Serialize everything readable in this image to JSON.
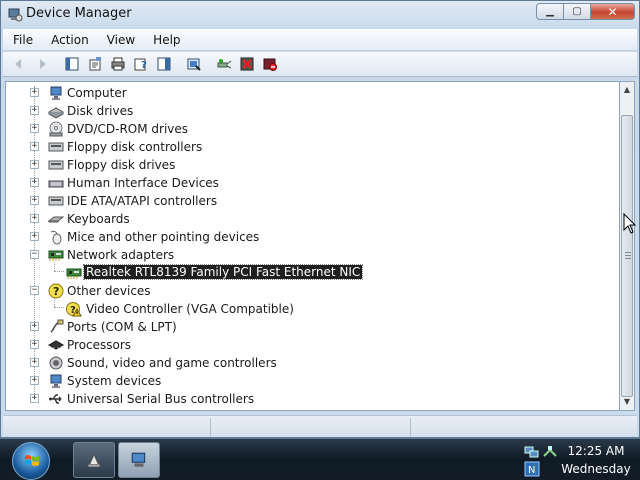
{
  "window": {
    "title": "Device Manager",
    "icon": "device-manager-icon",
    "caption_buttons": {
      "minimize": "minimize-icon",
      "maximize": "maximize-icon",
      "close": "close-icon"
    }
  },
  "menu": [
    "File",
    "Action",
    "View",
    "Help"
  ],
  "toolbar": [
    "back-icon",
    "forward-icon",
    "console-tree-icon",
    "properties-icon",
    "print-icon",
    "help-icon",
    "details-pane-icon",
    "update-driver-icon",
    "scan-hardware-icon",
    "uninstall-icon",
    "disable-icon"
  ],
  "tree": {
    "items": [
      {
        "label": "Computer",
        "icon": "computer-icon",
        "expander": "+"
      },
      {
        "label": "Disk drives",
        "icon": "disk-drive-icon",
        "expander": "+"
      },
      {
        "label": "DVD/CD-ROM drives",
        "icon": "cd-drive-icon",
        "expander": "+"
      },
      {
        "label": "Floppy disk controllers",
        "icon": "floppy-controller-icon",
        "expander": "+"
      },
      {
        "label": "Floppy disk drives",
        "icon": "floppy-drive-icon",
        "expander": "+"
      },
      {
        "label": "Human Interface Devices",
        "icon": "hid-icon",
        "expander": "+"
      },
      {
        "label": "IDE ATA/ATAPI controllers",
        "icon": "ide-controller-icon",
        "expander": "+"
      },
      {
        "label": "Keyboards",
        "icon": "keyboard-icon",
        "expander": "+"
      },
      {
        "label": "Mice and other pointing devices",
        "icon": "mouse-icon",
        "expander": "+"
      },
      {
        "label": "Network adapters",
        "icon": "network-adapter-icon",
        "expander": "−"
      },
      {
        "label": "Realtek RTL8139 Family PCI Fast Ethernet NIC",
        "icon": "nic-icon",
        "child": true,
        "selected": true
      },
      {
        "label": "Other devices",
        "icon": "other-devices-icon",
        "expander": "−"
      },
      {
        "label": "Video Controller (VGA Compatible)",
        "icon": "warning-device-icon",
        "child": true
      },
      {
        "label": "Ports (COM & LPT)",
        "icon": "port-icon",
        "expander": "+"
      },
      {
        "label": "Processors",
        "icon": "processor-icon",
        "expander": "+"
      },
      {
        "label": "Sound, video and game controllers",
        "icon": "sound-icon",
        "expander": "+"
      },
      {
        "label": "System devices",
        "icon": "system-devices-icon",
        "expander": "+"
      },
      {
        "label": "Universal Serial Bus controllers",
        "icon": "usb-icon",
        "expander": "+"
      }
    ]
  },
  "taskbar": {
    "start": "start-orb-icon",
    "buttons": [
      "task-app-icon",
      "device-manager-task-icon"
    ],
    "tray": [
      "network-tray-icon",
      "safely-remove-tray-icon",
      "ime-tray-icon"
    ],
    "time": "12:25 AM",
    "day": "Wednesday"
  },
  "colors": {
    "selection": "#1f1f1f",
    "taskbar": "#0f1a24",
    "window_frame": "#c9dbec"
  }
}
